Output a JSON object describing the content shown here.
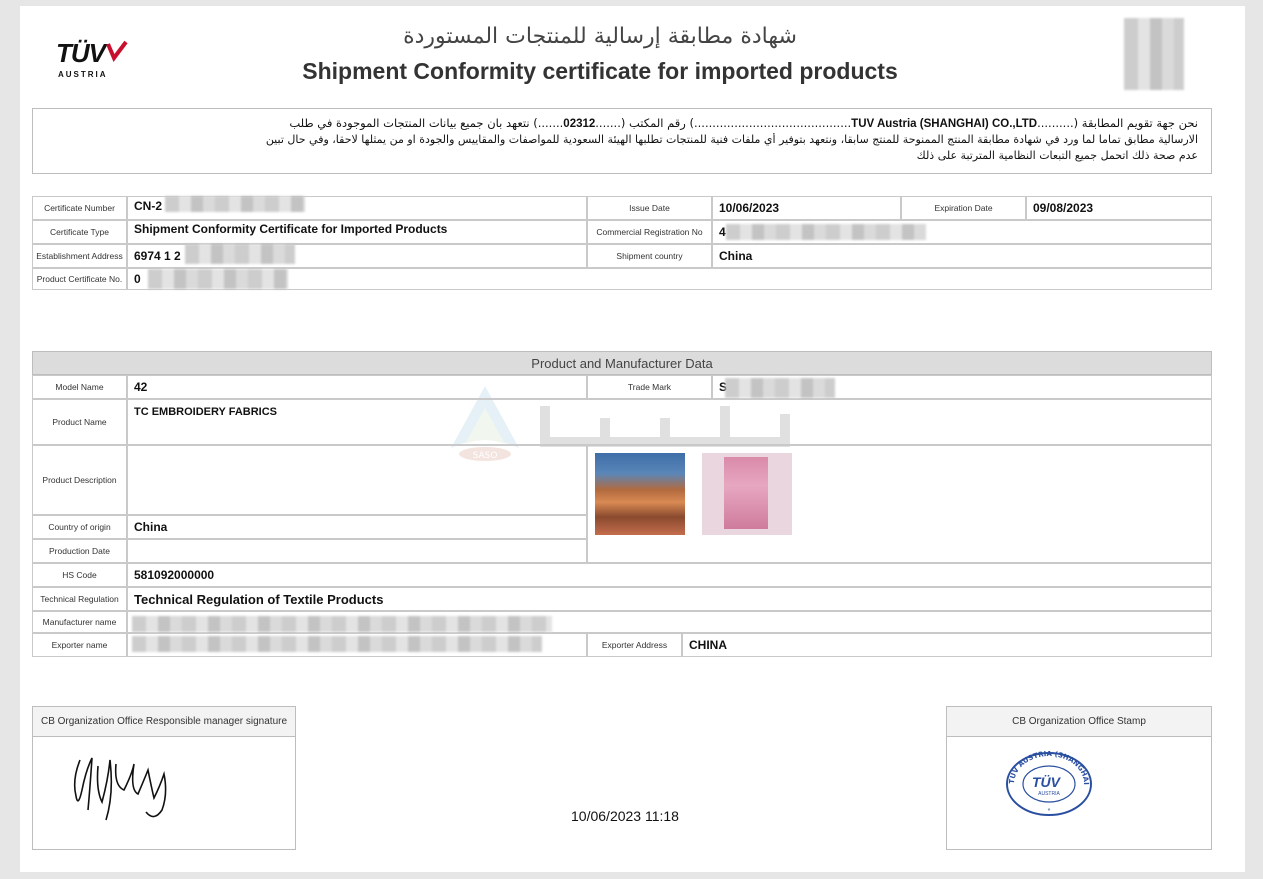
{
  "header": {
    "title_ar": "شهادة مطابقة إرسالية للمنتجات المستوردة",
    "title_en": "Shipment Conformity certificate for imported products",
    "logo_brand": "TÜV",
    "logo_sub": "AUSTRIA"
  },
  "declaration": {
    "line1_prefix": "نحن جهة تقويم المطابقة (",
    "cb_name": "TUV Austria (SHANGHAI) CO.,LTD",
    "line1_mid": ") رقم المكتب (",
    "office_no": "02312",
    "line1_suffix": ") نتعهد بان جميع بيانات المنتجات الموجودة في طلب",
    "line2": "الارسالية مطابق تماما لما ورد في شهادة مطابقة المنتج الممنوحة للمنتج سابقا، ونتعهد بتوفير أي ملفات فنية للمنتجات تطلبها الهيئة السعودية للمواصفات والمقاييس والجودة او من يمثلها لاحقا، وفي حال تبين",
    "line3": "عدم صحة ذلك اتحمل جميع التبعات النظامية المترتبة على ذلك"
  },
  "certificate": {
    "number_label": "Certificate Number",
    "number_value": "CN-2",
    "type_label": "Certificate Type",
    "type_value": "Shipment Conformity Certificate for Imported Products",
    "establishment_label": "Establishment Address",
    "establishment_value": "6974 1 2",
    "product_cert_label": "Product Certificate No.",
    "product_cert_value": "0",
    "issue_label": "Issue Date",
    "issue_value": "10/06/2023",
    "expiration_label": "Expiration Date",
    "expiration_value": "09/08/2023",
    "commercial_label": "Commercial Registration No",
    "commercial_value": "4",
    "shipment_country_label": "Shipment country",
    "shipment_country_value": "China"
  },
  "product": {
    "section_title": "Product and Manufacturer Data",
    "model_label": "Model Name",
    "model_value": "42",
    "trademark_label": "Trade Mark",
    "trademark_value": "S",
    "name_label": "Product Name",
    "name_value": "TC EMBROIDERY FABRICS",
    "description_label": "Product Description",
    "description_value": "",
    "origin_label": "Country of origin",
    "origin_value": "China",
    "production_label": "Production Date",
    "production_value": "",
    "hs_label": "HS Code",
    "hs_value": "581092000000",
    "regulation_label": "Technical Regulation",
    "regulation_value": "Technical Regulation of Textile Products",
    "manufacturer_label": "Manufacturer name",
    "exporter_label": "Exporter name",
    "exporter_address_label": "Exporter Address",
    "exporter_address_value": "CHINA",
    "watermark_text": "SASO"
  },
  "signature": {
    "label": "CB Organization Office Responsible manager signature",
    "timestamp": "10/06/2023 11:18",
    "stamp_label": "CB Organization Office Stamp",
    "stamp_ring_text": "TUV AUSTRIA (SHANGHAI) CO.,LTD.",
    "stamp_brand": "TÜV",
    "stamp_sub": "AUSTRIA"
  },
  "colors": {
    "tuv_red": "#c8102e",
    "stamp_blue": "#2a4fa0",
    "header_gray": "#dcdcdc"
  }
}
